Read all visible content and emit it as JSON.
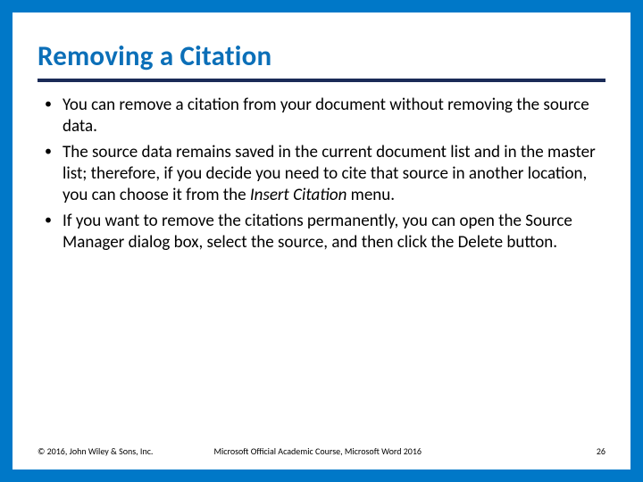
{
  "title": "Removing a Citation",
  "bullets": [
    {
      "text": "You can remove a citation from your document without removing the source data."
    },
    {
      "prefix": "The source data remains saved in the current document list and in the master list; therefore, if you decide you need to cite that source in another location, you can choose it from the ",
      "italic": "Insert Citation",
      "suffix": " menu."
    },
    {
      "text": "If you want to remove the citations permanently, you can open the Source Manager dialog box, select the source, and then click the Delete button."
    }
  ],
  "footer": {
    "copyright": "© 2016, John Wiley & Sons, Inc.",
    "course": "Microsoft Official Academic Course, Microsoft Word 2016",
    "page": "26"
  }
}
